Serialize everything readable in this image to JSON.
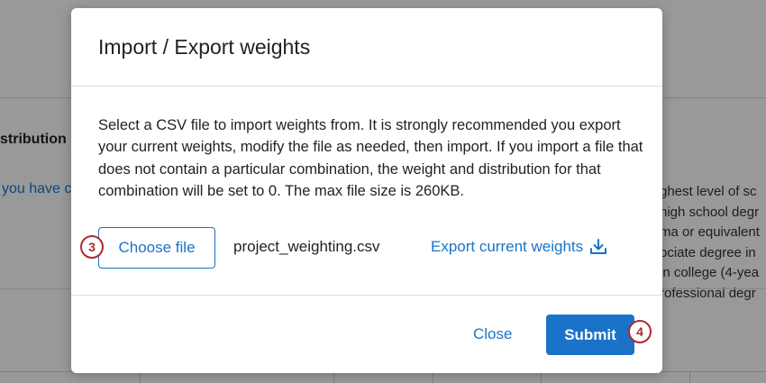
{
  "background": {
    "heading": "stribution",
    "link_text": "you have c",
    "right_list": [
      "ghest level of sc",
      "nigh school degr",
      "ma or equivalent",
      "ociate degree in",
      "in college (4-yea",
      "rofessional degr"
    ]
  },
  "modal": {
    "title": "Import / Export weights",
    "description": "Select a CSV file to import weights from. It is strongly recommended you export your current weights, modify the file as needed, then import. If you import a file that does not contain a particular combination, the weight and distribution for that combination will be set to 0. The max file size is 260KB.",
    "choose_file_label": "Choose file",
    "file_name": "project_weighting.csv",
    "export_label": "Export current weights",
    "export_icon": "download-icon",
    "close_label": "Close",
    "submit_label": "Submit"
  },
  "step_markers": {
    "choose_file_step": "3",
    "submit_step": "4"
  },
  "colors": {
    "accent": "#1a73c9",
    "marker": "#b3282d",
    "overlay": "rgba(0,0,0,0.40)"
  }
}
